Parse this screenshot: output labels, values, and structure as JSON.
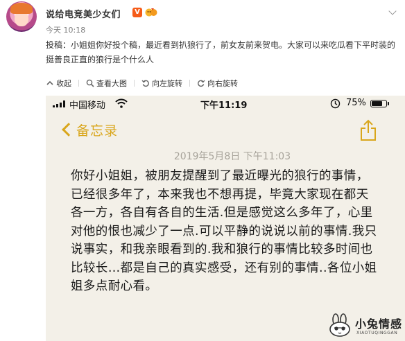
{
  "post": {
    "username": "说给电竞美少女们",
    "verified_badge": "V",
    "timestamp": "今天 10:18",
    "text": "投稿：小姐姐你好投个稿，最近看到扒狼行了，前女友前来贺电。大家可以来吃瓜看下平时装的挺善良正直的狼行是个什么人"
  },
  "toolbar": {
    "collapse": "收起",
    "view_large": "查看大图",
    "rotate_left": "向左旋转",
    "rotate_right": "向右旋转"
  },
  "phone": {
    "carrier": "中国移动",
    "time": "下午11:19",
    "battery_percent": "75%",
    "battery_level": 0.75,
    "back_label": "备忘录",
    "note_date": "2019年5月8日 下午11:03",
    "note_body": "你好小姐姐，被朋友提醒到了最近曝光的狼行的事情，已经很多年了，本来我也不想再提，毕竟大家现在都天各一方，各自有各自的生活.但是感觉这么多年了，心里对他的恨也减少了一点.可以平静的说说以前的事情.我只说事实，和我亲眼看到的.我和狼行的事情比较多时间也比较长…都是自己的真实感受，还有别的事情..各位小姐姐多点耐心看。"
  },
  "watermark": {
    "title": "小兔情感",
    "subtitle": "XIAOTUQINGGAN"
  },
  "colors": {
    "accent_orange": "#f55b18",
    "notes_gold": "#d9a61b",
    "notes_bg": "#f3f0e8"
  }
}
